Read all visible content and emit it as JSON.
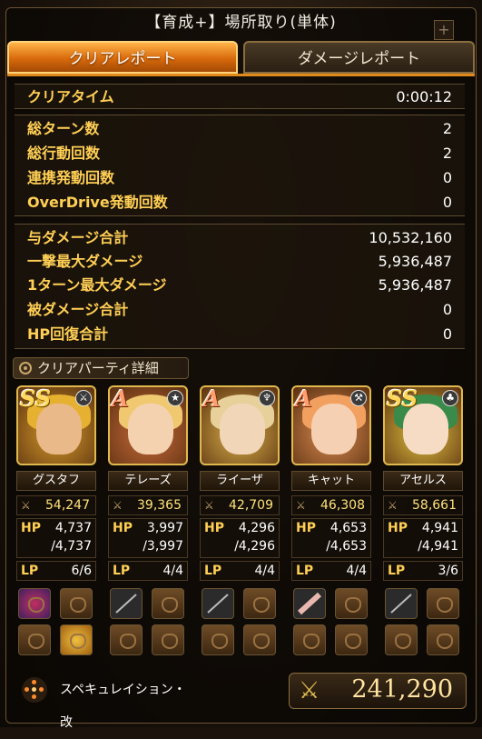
{
  "header": {
    "title": "【育成+】場所取り(単体)",
    "plus": "+"
  },
  "tabs": {
    "clear_report": "クリアレポート",
    "damage_report": "ダメージレポート"
  },
  "clear_time": {
    "label": "クリアタイム",
    "value": "0:00:12"
  },
  "turn_stats": [
    {
      "label": "総ターン数",
      "value": "2"
    },
    {
      "label": "総行動回数",
      "value": "2"
    },
    {
      "label": "連携発動回数",
      "value": "0"
    },
    {
      "label": "OverDrive発動回数",
      "value": "0"
    }
  ],
  "damage_stats": [
    {
      "label": "与ダメージ合計",
      "value": "10,532,160"
    },
    {
      "label": "一撃最大ダメージ",
      "value": "5,936,487"
    },
    {
      "label": "1ターン最大ダメージ",
      "value": "5,936,487"
    },
    {
      "label": "被ダメージ合計",
      "value": "0"
    },
    {
      "label": "HP回復合計",
      "value": "0"
    }
  ],
  "party_section": {
    "label": "クリアパーティ詳細"
  },
  "party": [
    {
      "rank": "SS",
      "name": "グスタフ",
      "power": "54,247",
      "hp": "4,737",
      "hp_max": "/4,737",
      "lp": "6/6",
      "colors": {
        "bg": "#d49a2a",
        "hair": "#e6b030",
        "face": "#e9b98a"
      }
    },
    {
      "rank": "A",
      "name": "テレーズ",
      "power": "39,365",
      "hp": "3,997",
      "hp_max": "/3,997",
      "lp": "4/4",
      "colors": {
        "bg": "#c96a3a",
        "hair": "#f0c870",
        "face": "#f4d2b0"
      }
    },
    {
      "rank": "A",
      "name": "ライーザ",
      "power": "42,709",
      "hp": "4,296",
      "hp_max": "/4,296",
      "lp": "4/4",
      "colors": {
        "bg": "#d8b04a",
        "hair": "#e8d09a",
        "face": "#f2d6b8"
      }
    },
    {
      "rank": "A",
      "name": "キャット",
      "power": "46,308",
      "hp": "4,653",
      "hp_max": "/4,653",
      "lp": "4/4",
      "colors": {
        "bg": "#d88a50",
        "hair": "#f2a060",
        "face": "#f5d0b2"
      }
    },
    {
      "rank": "SS",
      "name": "アセルス",
      "power": "58,661",
      "hp": "4,941",
      "hp_max": "/4,941",
      "lp": "3/6",
      "colors": {
        "bg": "#e0c040",
        "hair": "#3a8a4a",
        "face": "#f6dcc4"
      }
    }
  ],
  "stat_labels": {
    "hp": "HP",
    "lp": "LP"
  },
  "formation": {
    "label": "スペキュレイション・改"
  },
  "total_power": "241,290"
}
